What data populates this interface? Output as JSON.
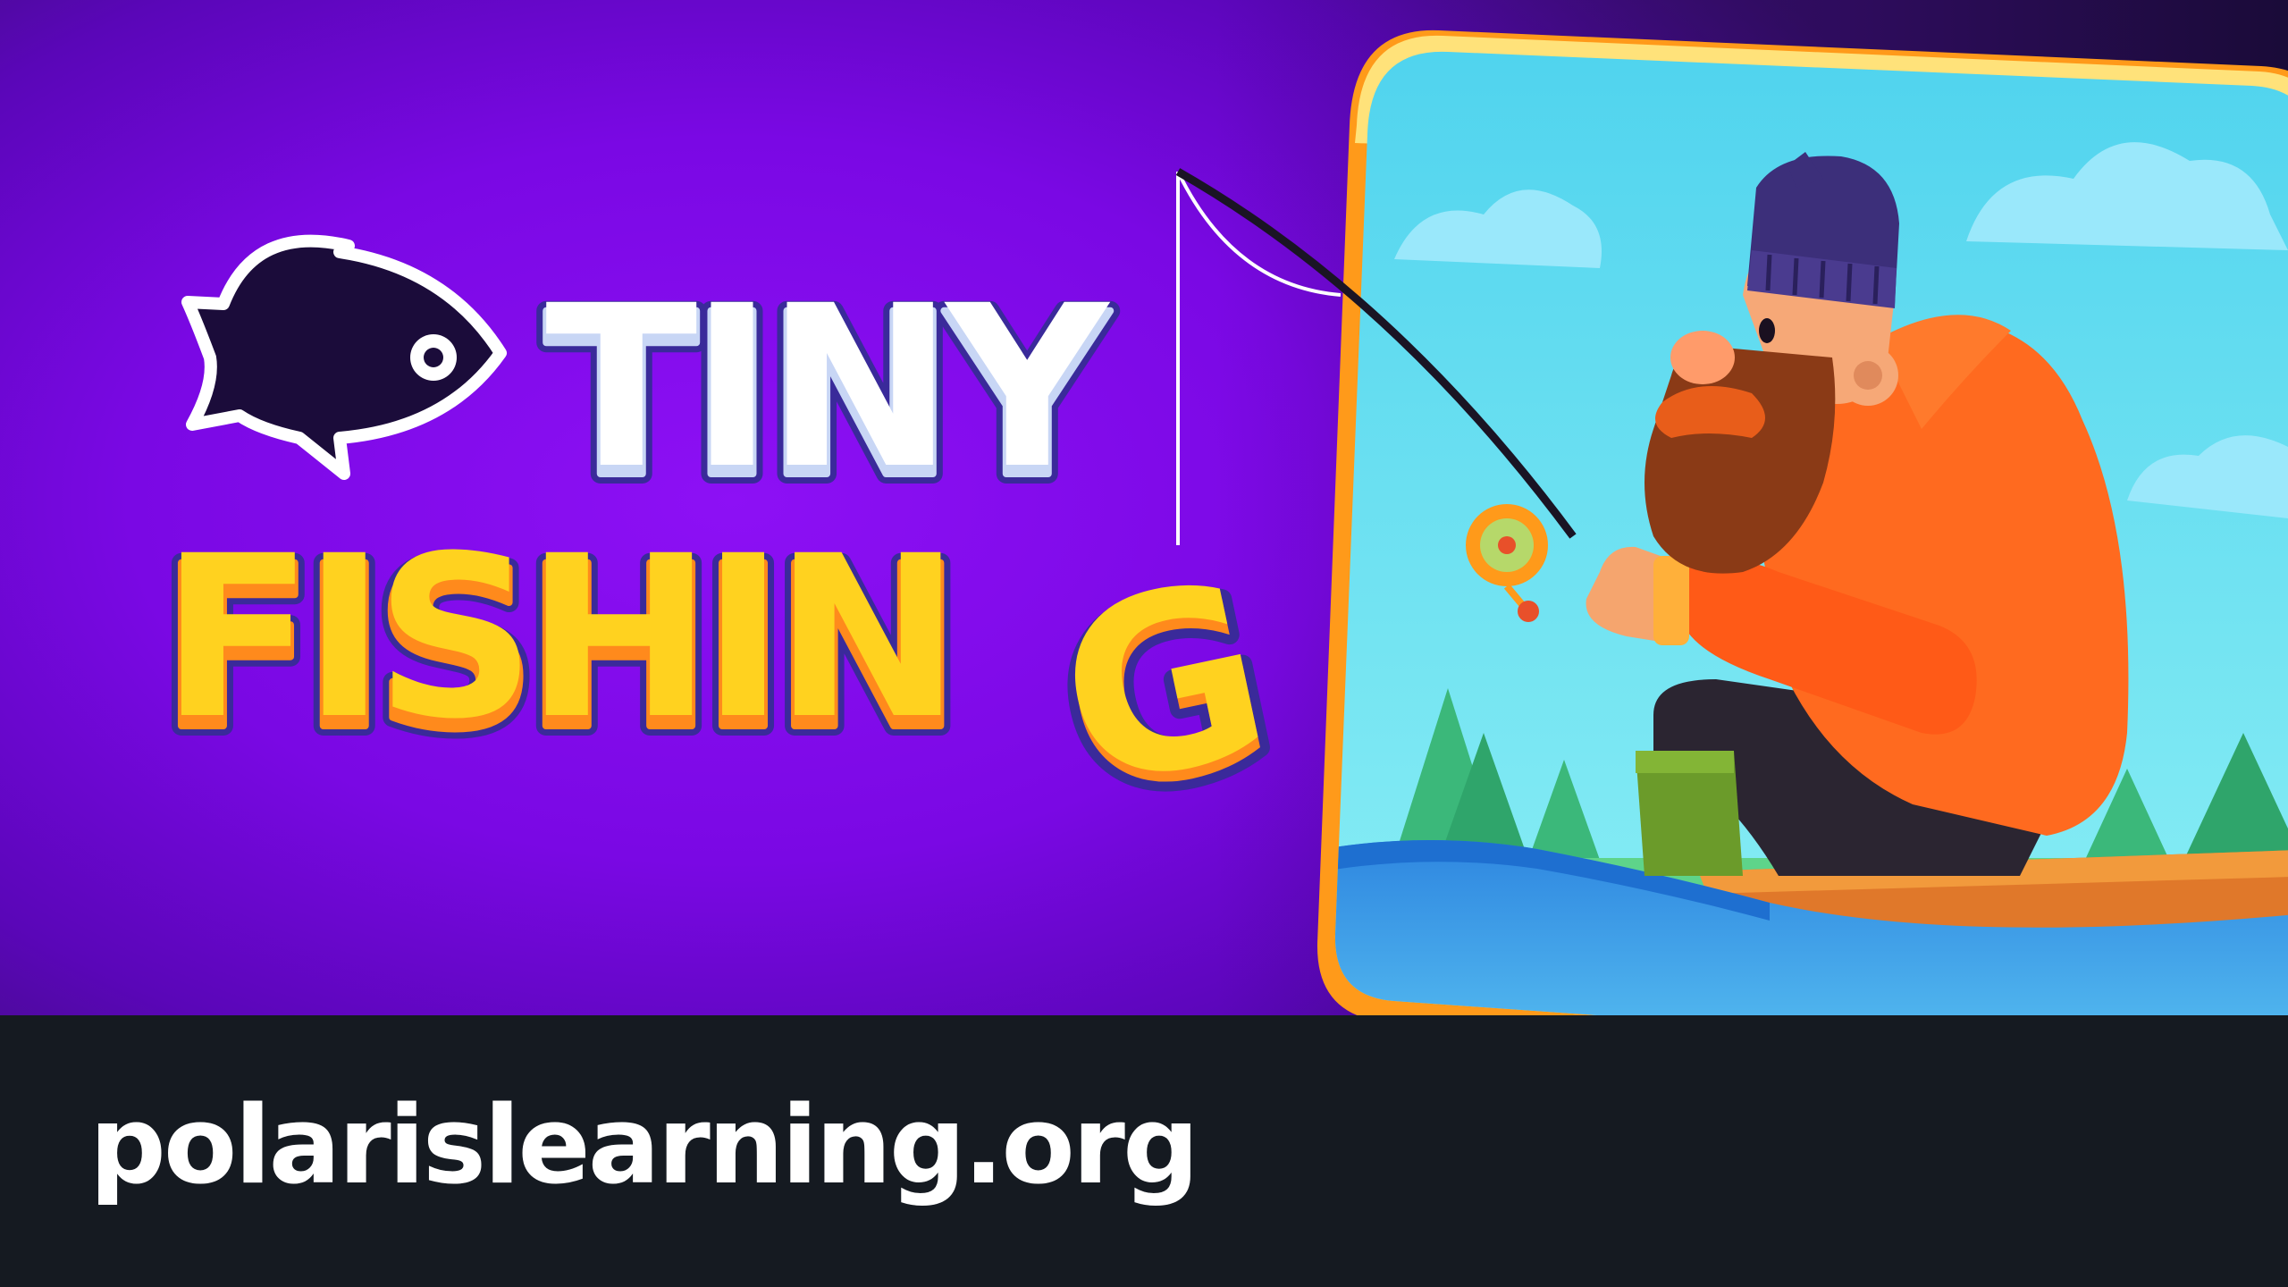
{
  "game": {
    "title_line1": "TINY",
    "title_line2_main": "FISHIN",
    "title_line2_end": "G"
  },
  "footer": {
    "site_url": "polarislearning.org"
  },
  "icons": {
    "logo_fish": "fish-silhouette-icon",
    "artwork": "fisherman-in-boat-illustration"
  },
  "colors": {
    "background_purple": "#8d10f5",
    "title_white": "#ffffff",
    "title_yellow": "#ffd21f",
    "title_outline": "#3a2a9a",
    "footer_bar": "#151a21",
    "card_frame": "#ff9a1a"
  }
}
